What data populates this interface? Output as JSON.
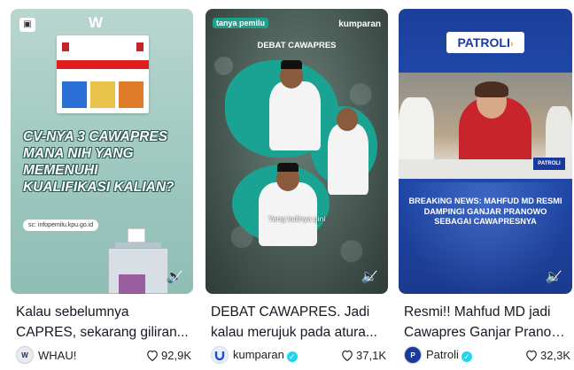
{
  "cards": [
    {
      "caption_line1": "Kalau sebelumnya",
      "caption_line2": "CAPRES, sekarang giliran...",
      "author": "WHAU!",
      "likes": "92,9K",
      "verified": false,
      "thumb": {
        "headline": "CV-NYA 3 CAWAPRES MANA NIH YANG MEMENUHI KUALIFIKASI KALIAN?",
        "url": "sc: infopemilu.kpu.go.id",
        "logo": "W"
      }
    },
    {
      "caption_line1": "DEBAT CAWAPRES. Jadi",
      "caption_line2": "kalau merujuk pada atura...",
      "author": "kumparan",
      "likes": "37,1K",
      "verified": true,
      "thumb": {
        "badge_left": "tanya pemilu",
        "badge_right": "kumparan",
        "title": "DEBAT CAWAPRES",
        "subtitle": "Yang tadinya gini"
      }
    },
    {
      "caption_line1": "Resmi!! Mahfud MD jadi",
      "caption_line2": "Cawapres Ganjar Pranow...",
      "author": "Patroli",
      "likes": "32,3K",
      "verified": true,
      "thumb": {
        "brand": "PATROLI",
        "lower_third": "PATROLI",
        "breaking": "BREAKING NEWS: MAHFUD MD RESMI DAMPINGI GANJAR PRANOWO SEBAGAI CAWAPRESNYA"
      }
    }
  ],
  "icons": {
    "mute": "volume-mute-icon",
    "like": "heart-outline-icon",
    "verified": "verified-check-icon"
  },
  "colors": {
    "verified": "#20d5ec",
    "caption_text": "#161823",
    "teal_accent": "#1aa392",
    "news_blue": "#1a3a9e"
  }
}
